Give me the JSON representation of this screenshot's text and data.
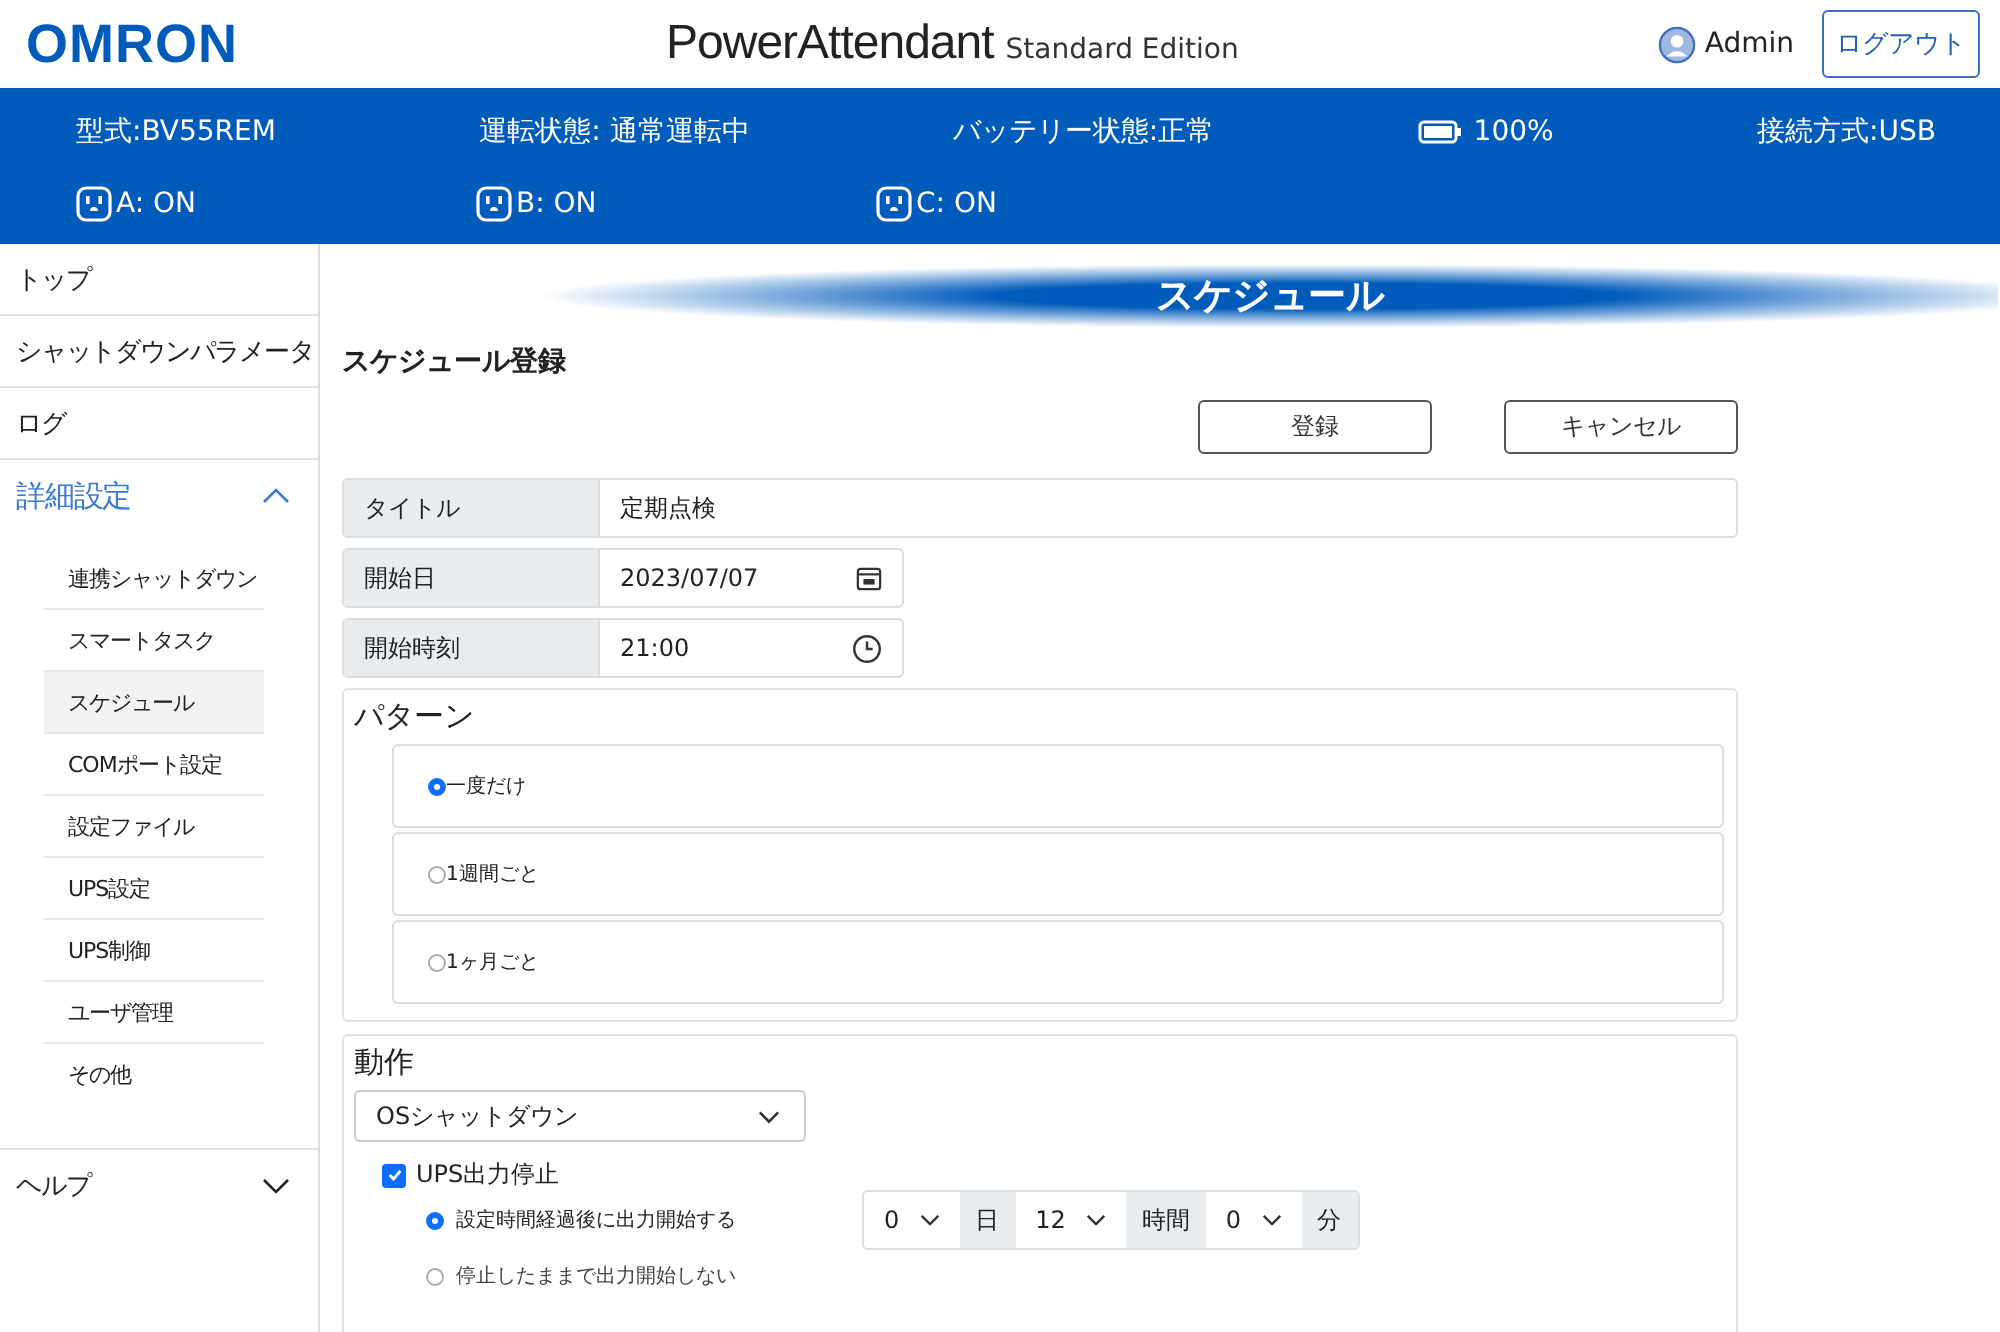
{
  "header": {
    "logo": "OMRON",
    "product": "PowerAttendant",
    "edition": "Standard Edition",
    "user": "Admin",
    "logout": "ログアウト"
  },
  "status": {
    "items": [
      {
        "kind": "text",
        "text": "型式:BV55REM"
      },
      {
        "kind": "text",
        "text": "運転状態: 通常運転中"
      },
      {
        "kind": "text",
        "text": "バッテリー状態:正常"
      },
      {
        "kind": "battery",
        "text": "100%"
      },
      {
        "kind": "text",
        "text": "接続方式:USB"
      }
    ],
    "outlets": [
      {
        "label": "A: ON"
      },
      {
        "label": "B: ON"
      },
      {
        "label": "C: ON"
      }
    ]
  },
  "sidebar": {
    "items": [
      {
        "kind": "link",
        "label": "トップ"
      },
      {
        "kind": "link",
        "label": "シャットダウンパラメータ"
      },
      {
        "kind": "link",
        "label": "ログ"
      },
      {
        "kind": "group",
        "label": "詳細設定",
        "expanded": true,
        "children": [
          {
            "label": "連携シャットダウン",
            "selected": false
          },
          {
            "label": "スマートタスク",
            "selected": false
          },
          {
            "label": "スケジュール",
            "selected": true
          },
          {
            "label": "COMポート設定",
            "selected": false
          },
          {
            "label": "設定ファイル",
            "selected": false
          },
          {
            "label": "UPS設定",
            "selected": false
          },
          {
            "label": "UPS制御",
            "selected": false
          },
          {
            "label": "ユーザ管理",
            "selected": false
          },
          {
            "label": "その他",
            "selected": false
          }
        ]
      },
      {
        "kind": "group",
        "label": "ヘルプ",
        "expanded": false
      }
    ]
  },
  "page_title": "スケジュール",
  "section_title": "スケジュール登録",
  "buttons": [
    "登録",
    "キャンセル"
  ],
  "fields": [
    {
      "kind": "text",
      "label": "タイトル",
      "value": "定期点検"
    },
    {
      "kind": "date",
      "label": "開始日",
      "value": "2023/07/07"
    },
    {
      "kind": "time",
      "label": "開始時刻",
      "value": "21:00"
    }
  ],
  "pattern": {
    "title": "パターン",
    "options": [
      {
        "label": "一度だけ",
        "selected": true
      },
      {
        "label": "1週間ごと",
        "selected": false
      },
      {
        "label": "1ヶ月ごと",
        "selected": false
      }
    ]
  },
  "action": {
    "title": "動作",
    "select": "OSシャットダウン",
    "ups_stop": {
      "label": "UPS出力停止",
      "checked": true
    },
    "restart_options": [
      {
        "label": "設定時間経過後に出力開始する",
        "selected": true
      },
      {
        "label": "停止したままで出力開始しない",
        "selected": false
      }
    ],
    "delay": [
      {
        "value": "0",
        "unit": "日"
      },
      {
        "value": "12",
        "unit": "時間"
      },
      {
        "value": "0",
        "unit": "分"
      }
    ]
  }
}
